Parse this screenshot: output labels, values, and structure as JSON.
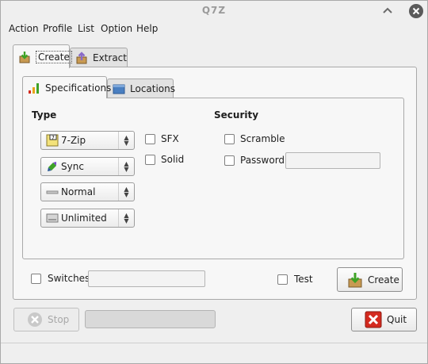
{
  "window": {
    "title": "Q7Z"
  },
  "menu": [
    "Action",
    "Profile",
    "List",
    "Option",
    "Help"
  ],
  "outer_tabs": [
    {
      "label": "Create",
      "icon": "create-box-icon",
      "active": true
    },
    {
      "label": "Extract",
      "icon": "extract-box-icon",
      "active": false
    }
  ],
  "inner_tabs": [
    {
      "label": "Specifications",
      "icon": "signal-bars-icon",
      "active": true
    },
    {
      "label": "Locations",
      "icon": "folder-icon",
      "active": false
    }
  ],
  "type_section": {
    "title": "Type",
    "combos": [
      {
        "value": "7-Zip",
        "icon": "archive-format-icon"
      },
      {
        "value": "Sync",
        "icon": "sync-arrows-icon"
      },
      {
        "value": "Normal",
        "icon": "compression-level-icon"
      },
      {
        "value": "Unlimited",
        "icon": "drive-icon"
      }
    ],
    "checks": [
      {
        "label": "SFX",
        "checked": false
      },
      {
        "label": "Solid",
        "checked": false
      }
    ]
  },
  "security_section": {
    "title": "Security",
    "checks": [
      {
        "label": "Scramble",
        "checked": false
      },
      {
        "label": "Password",
        "checked": false
      }
    ],
    "password_value": ""
  },
  "switches": {
    "label": "Switches",
    "checked": false,
    "value": ""
  },
  "test": {
    "label": "Test",
    "checked": false
  },
  "buttons": {
    "create": "Create",
    "stop": "Stop",
    "quit": "Quit"
  },
  "progress": {
    "fraction": 0
  },
  "colors": {
    "window_bg": "#efefef",
    "panel_bg": "#f7f7f7",
    "accent_green": "#3ea226",
    "quit_red": "#d42a1f"
  }
}
